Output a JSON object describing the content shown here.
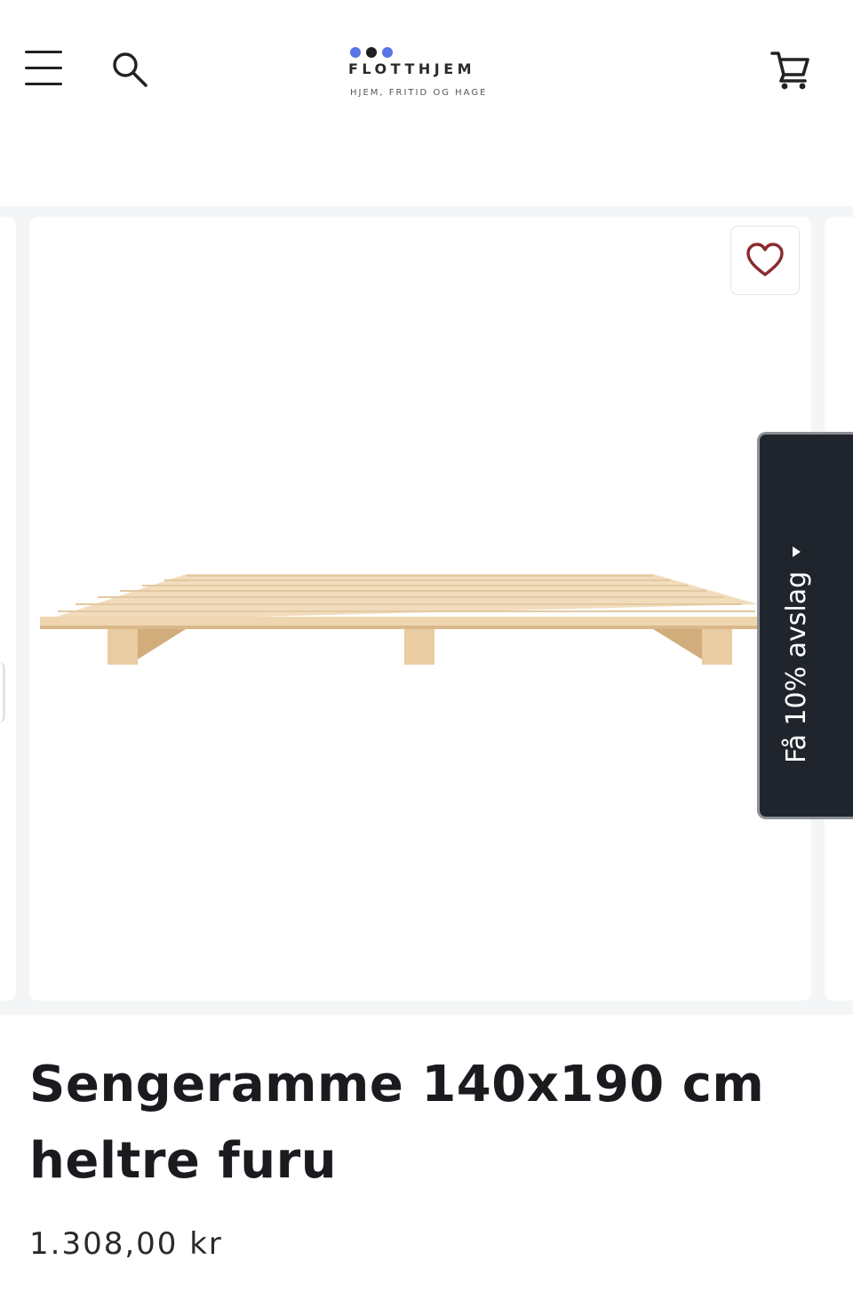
{
  "header": {
    "brand_name": "FLOTTHJEM",
    "brand_tagline": "HJEM, FRITID OG HAGE",
    "brand_dot_colors": [
      "#5b74e6",
      "#1f1f23",
      "#5b74e6"
    ],
    "icons": {
      "menu": "hamburger-menu-icon",
      "search": "search-icon",
      "cart": "shopping-cart-icon"
    }
  },
  "gallery": {
    "favorite_icon": "heart-icon",
    "favorite_color": "#8b2a2e"
  },
  "discount_tab": {
    "label": "Få 10% avslag",
    "background": "#20252d"
  },
  "product": {
    "title": "Sengeramme 140x190 cm heltre furu",
    "price": "1.308,00 kr"
  }
}
